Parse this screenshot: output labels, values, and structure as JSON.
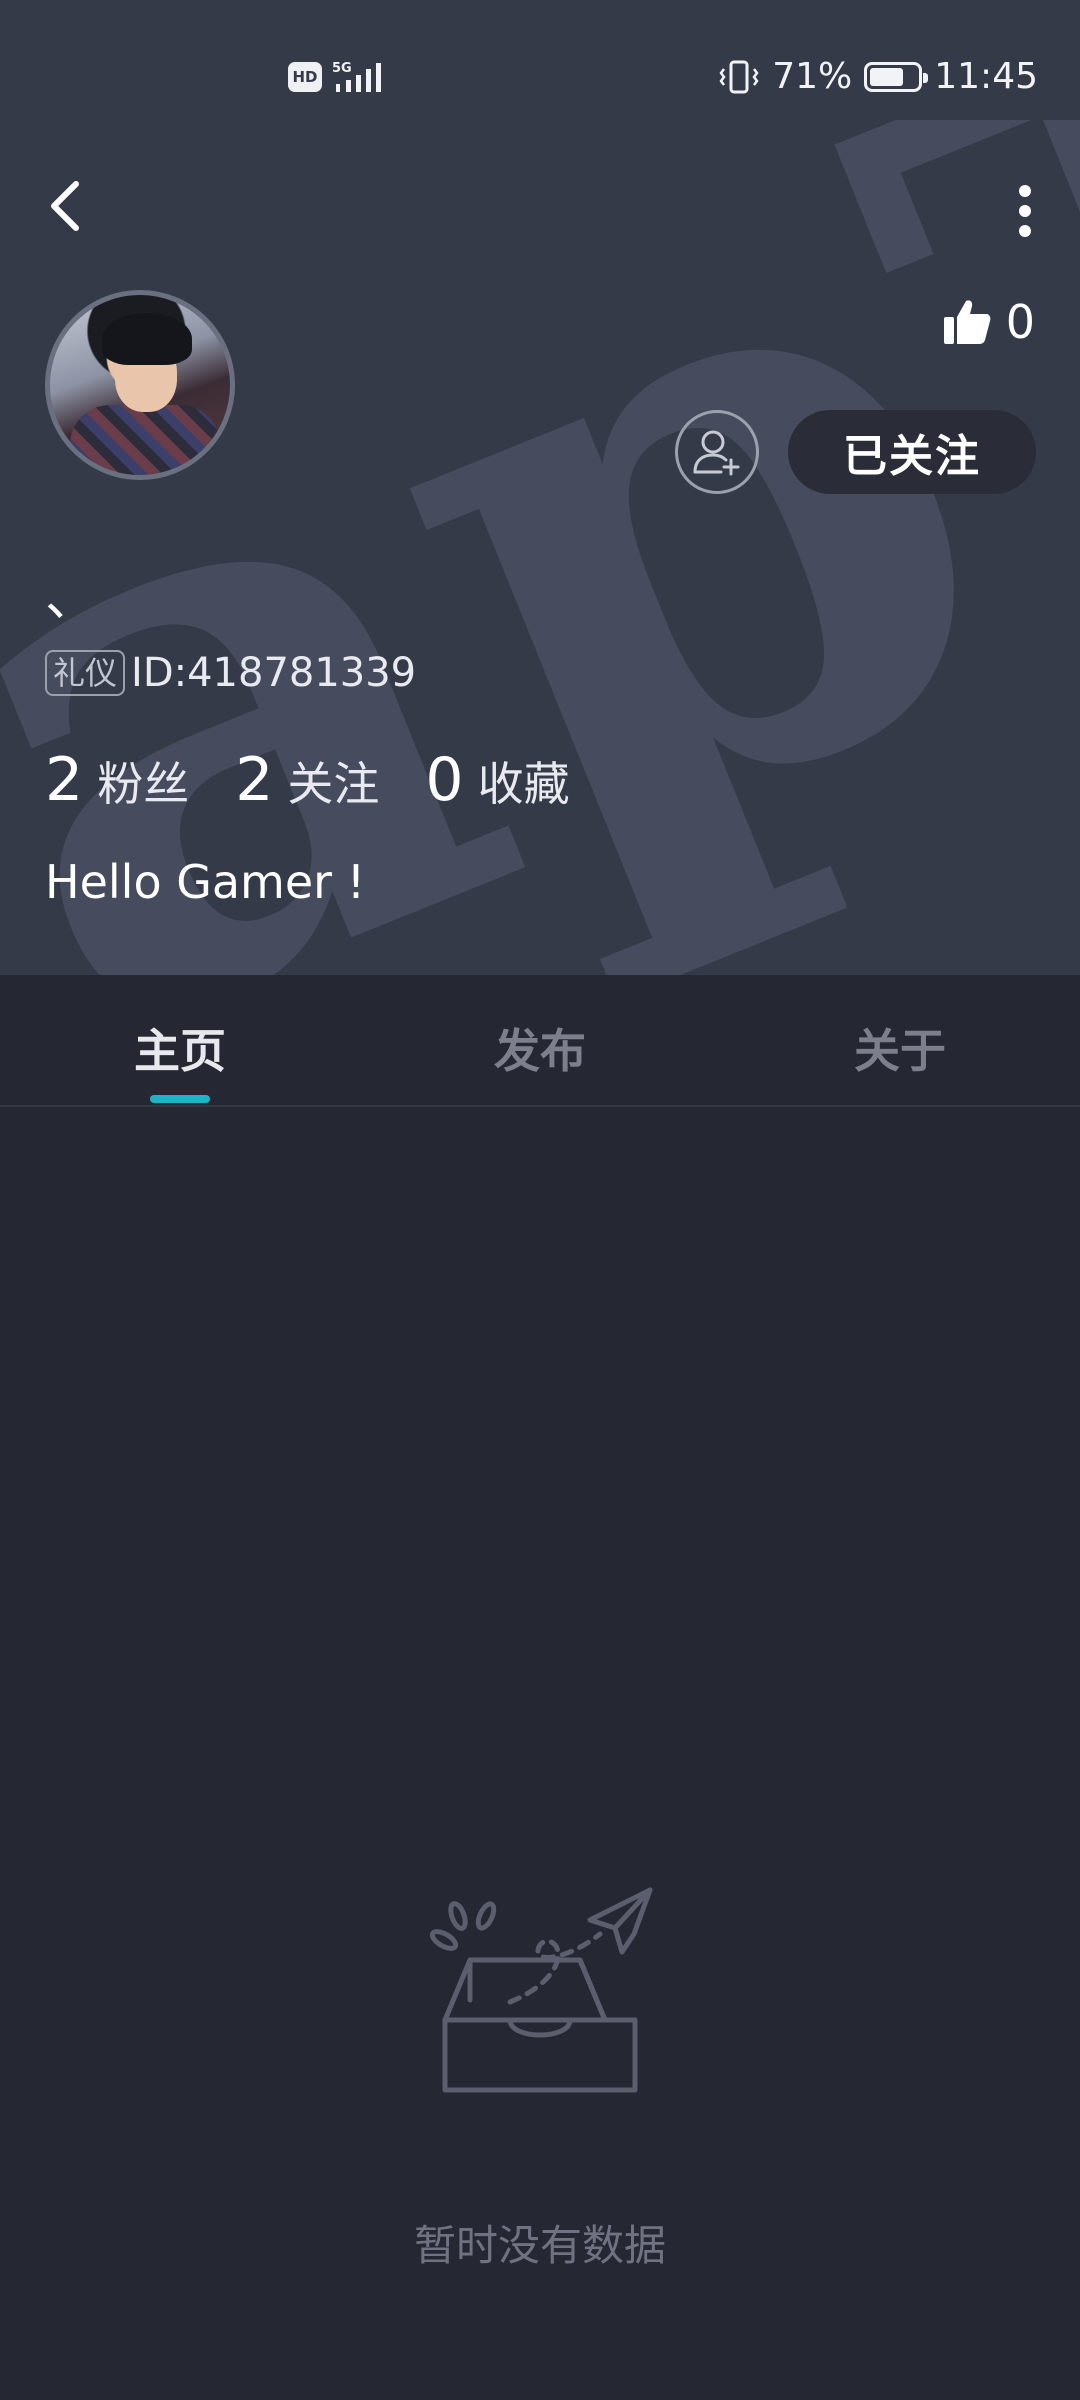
{
  "status_bar": {
    "hd_label": "HD",
    "network": "5G",
    "battery_percent": "71%",
    "battery_level": 0.71,
    "time": "11:45",
    "icons": [
      "hd-icon",
      "signal-5g-icon",
      "vibrate-icon",
      "battery-icon"
    ]
  },
  "header": {
    "back_icon": "chevron-left-icon",
    "more_icon": "more-vertical-icon",
    "watermark_text": "apTa"
  },
  "profile": {
    "username": "、",
    "tag": "礼仪",
    "id_text": "ID:418781339",
    "likes_count": "0",
    "follow_label": "已关注",
    "bio": "Hello Gamer !",
    "stats": [
      {
        "value": "2",
        "label": "粉丝"
      },
      {
        "value": "2",
        "label": "关注"
      },
      {
        "value": "0",
        "label": "收藏"
      }
    ]
  },
  "tabs": [
    {
      "label": "主页",
      "active": true
    },
    {
      "label": "发布",
      "active": false
    },
    {
      "label": "关于",
      "active": false
    }
  ],
  "empty_state": {
    "text": "暂时没有数据",
    "icon": "empty-inbox-paper-plane-icon"
  },
  "colors": {
    "header_bg": "#353a49",
    "page_bg": "#252733",
    "accent": "#1fb3c8"
  }
}
